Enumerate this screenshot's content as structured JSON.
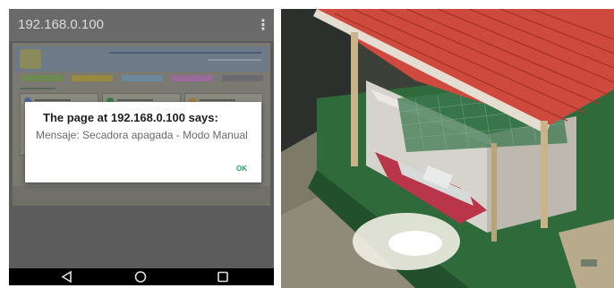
{
  "browser": {
    "url": "192.168.0.100",
    "menu_icon": "more-vert-icon"
  },
  "dialog": {
    "title": "The page at 192.168.0.100 says:",
    "message": "Mensaje: Secadora apagada - Modo Manual",
    "ok_label": "OK"
  },
  "navbar": {
    "back_icon": "back-triangle-icon",
    "home_icon": "home-circle-icon",
    "recent_icon": "recent-square-icon"
  },
  "colors": {
    "ok_green": "#27a35a",
    "roof_red": "#d8473c",
    "board_green": "#2f6a3a"
  }
}
